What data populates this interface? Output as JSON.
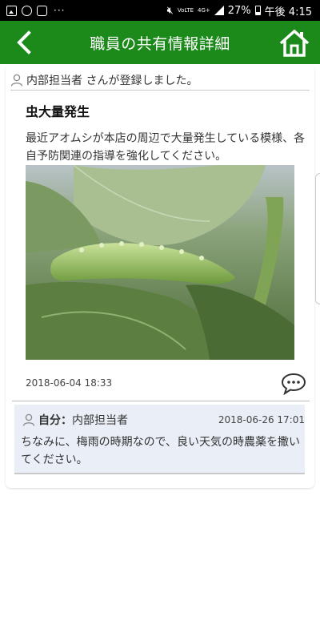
{
  "status_bar": {
    "battery": "27%",
    "time": "午後 4:15",
    "network": "4G+",
    "dots": "···",
    "volte": "VoLTE"
  },
  "header": {
    "title": "職員の共有情報詳細",
    "accent": "#1b8a1a"
  },
  "post": {
    "registered_by": "内部担当者 さんが登録しました。",
    "title": "虫大量発生",
    "body": "最近アオムシが本店の周辺で大量発生している模様、各自予防関連の指導を強化してください。",
    "date": "2018-06-04 18:33"
  },
  "reply": {
    "self_label": "自分：",
    "author": "内部担当者",
    "time": "2018-06-26 17:01",
    "text": "ちなみに、梅雨の時期なので、良い天気の時農薬を撒いてください。"
  },
  "icons": {
    "back": "chevron-left-icon",
    "home": "home-icon",
    "person": "person-icon",
    "comment": "comment-bubble-icon"
  }
}
